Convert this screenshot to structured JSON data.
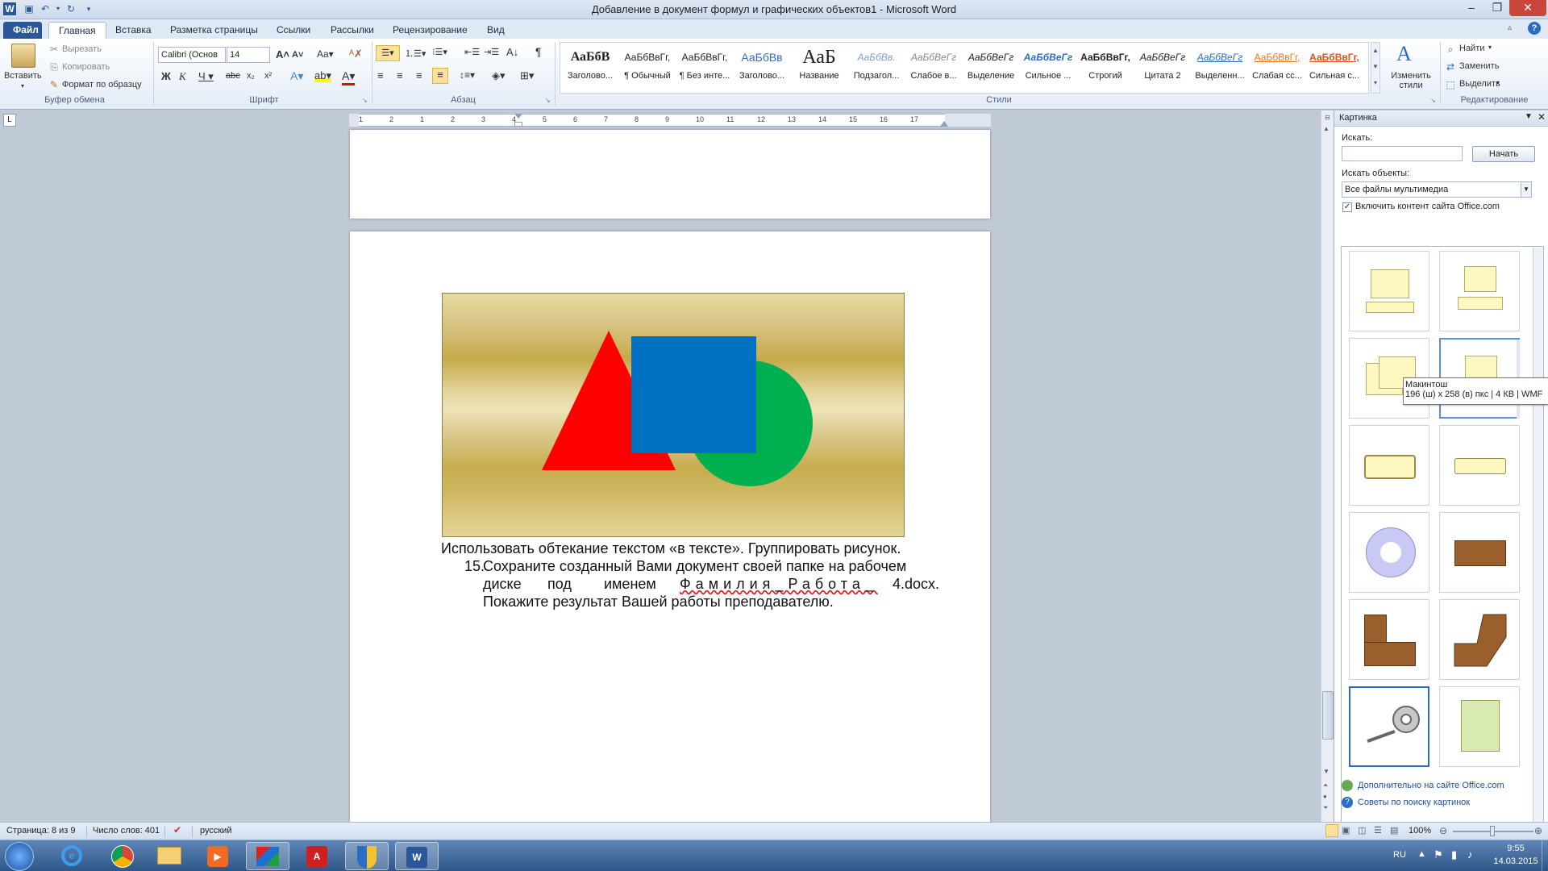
{
  "window": {
    "title": "Добавление в документ формул и графических объектов1 - Microsoft Word"
  },
  "tabs": [
    {
      "label": "Файл"
    },
    {
      "label": "Главная"
    },
    {
      "label": "Вставка"
    },
    {
      "label": "Разметка страницы"
    },
    {
      "label": "Ссылки"
    },
    {
      "label": "Рассылки"
    },
    {
      "label": "Рецензирование"
    },
    {
      "label": "Вид"
    }
  ],
  "ribbon": {
    "clipboard": {
      "paste_label": "Вставить",
      "cut_label": "Вырезать",
      "copy_label": "Копировать",
      "format_label": "Формат по образцу",
      "group_label": "Буфер обмена"
    },
    "font": {
      "font_name": "Calibri (Основ",
      "font_size": "14",
      "group_label": "Шрифт"
    },
    "paragraph": {
      "group_label": "Абзац"
    },
    "styles": {
      "group_label": "Стили",
      "items": [
        {
          "sample": "АаБбВ",
          "name": "Заголово..."
        },
        {
          "sample": "АаБбВвГг,",
          "name": "¶ Обычный"
        },
        {
          "sample": "АаБбВвГг,",
          "name": "¶ Без инте..."
        },
        {
          "sample": "АаБбВв",
          "name": "Заголово..."
        },
        {
          "sample": "АаБ",
          "name": "Название"
        },
        {
          "sample": "АаБбВв.",
          "name": "Подзагол..."
        },
        {
          "sample": "АаБбВеГг",
          "name": "Слабое в..."
        },
        {
          "sample": "АаБбВеГг",
          "name": "Выделение"
        },
        {
          "sample": "АаБбВеГг",
          "name": "Сильное ..."
        },
        {
          "sample": "АаБбВвГг,",
          "name": "Строгий"
        },
        {
          "sample": "АаБбВеГг",
          "name": "Цитата 2"
        },
        {
          "sample": "АаБбВеГг",
          "name": "Выделенн..."
        },
        {
          "sample": "АаБбВвГг,",
          "name": "Слабая сс..."
        },
        {
          "sample": "АаБбВвГг,",
          "name": "Сильная с..."
        }
      ],
      "change_label": "Изменить стили"
    },
    "editing": {
      "find_label": "Найти",
      "replace_label": "Заменить",
      "select_label": "Выделить",
      "group_label": "Редактирование"
    }
  },
  "ruler": {
    "numbers": [
      "1",
      "2",
      "1",
      "2",
      "3",
      "4",
      "5",
      "6",
      "7",
      "8",
      "9",
      "10",
      "11",
      "12",
      "13",
      "14",
      "15",
      "16",
      "17"
    ]
  },
  "document": {
    "caption_line": "Использовать обтекание текстом «в тексте». Группировать рисунок.",
    "item_number": "15.",
    "item_line1": "Сохраните созданный Вами документ своей папке на рабочем",
    "item_line2_a": "диске",
    "item_line2_b": "под",
    "item_line2_c": "именем",
    "item_line2_d": "Фамилия_Работа_",
    "item_line2_e": "4.docx.",
    "item_line3": "Покажите результат Вашей работы преподавателю."
  },
  "clipart_pane": {
    "title": "Картинка",
    "search_label": "Искать:",
    "search_value": "",
    "start_button": "Начать",
    "objects_label": "Искать объекты:",
    "objects_value": "Все файлы мультимедиа",
    "office_checkbox_label": "Включить контент сайта Office.com",
    "office_checked": true,
    "tooltip_name": "Макинтош",
    "tooltip_info": "196 (ш) x 258 (в) пкс | 4 КВ | WMF",
    "more_link": "Дополнительно на сайте Office.com",
    "tips_link": "Советы по поиску картинок"
  },
  "status": {
    "page": "Страница: 8 из 9",
    "words": "Число слов: 401",
    "language": "русский",
    "zoom": "100%"
  },
  "taskbar": {
    "lang": "RU",
    "time": "9:55",
    "date": "14.03.2015"
  },
  "colors": {
    "triangle": "#ff0000",
    "square": "#0070c0",
    "circle": "#00b050",
    "file_tab": "#2b579a"
  }
}
